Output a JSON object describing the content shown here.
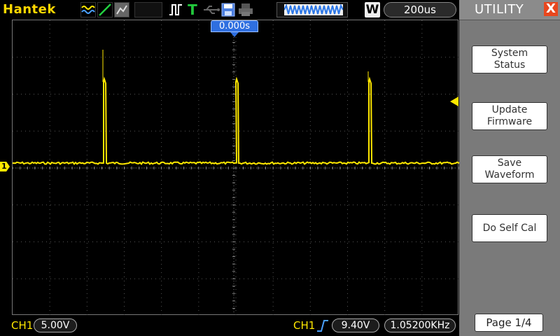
{
  "brand": "Hantek",
  "toolbar": {
    "mode_icons": [
      "wave-icon",
      "line-icon",
      "dots-icon"
    ],
    "trigger_T": "T",
    "run_label": "W",
    "timebase": "200us"
  },
  "trigger_time_marker": "0.000s",
  "ch1_marker": "1",
  "bottom": {
    "ch1_label": "CH1",
    "ch1_scale": "5.00V",
    "trig_source": "CH1",
    "trig_level": "9.40V",
    "frequency": "1.05200KHz"
  },
  "panel": {
    "title": "UTILITY",
    "close": "X",
    "buttons": [
      {
        "label": "System\nStatus"
      },
      {
        "label": "Update\nFirmware"
      },
      {
        "label": "Save\nWaveform"
      },
      {
        "label": "Do Self Cal"
      }
    ],
    "page": "Page 1/4"
  },
  "colors": {
    "trace": "#ffe800",
    "brand": "#ffd800",
    "marker_blue": "#2f6fe0",
    "panel": "#7a7a7a"
  }
}
